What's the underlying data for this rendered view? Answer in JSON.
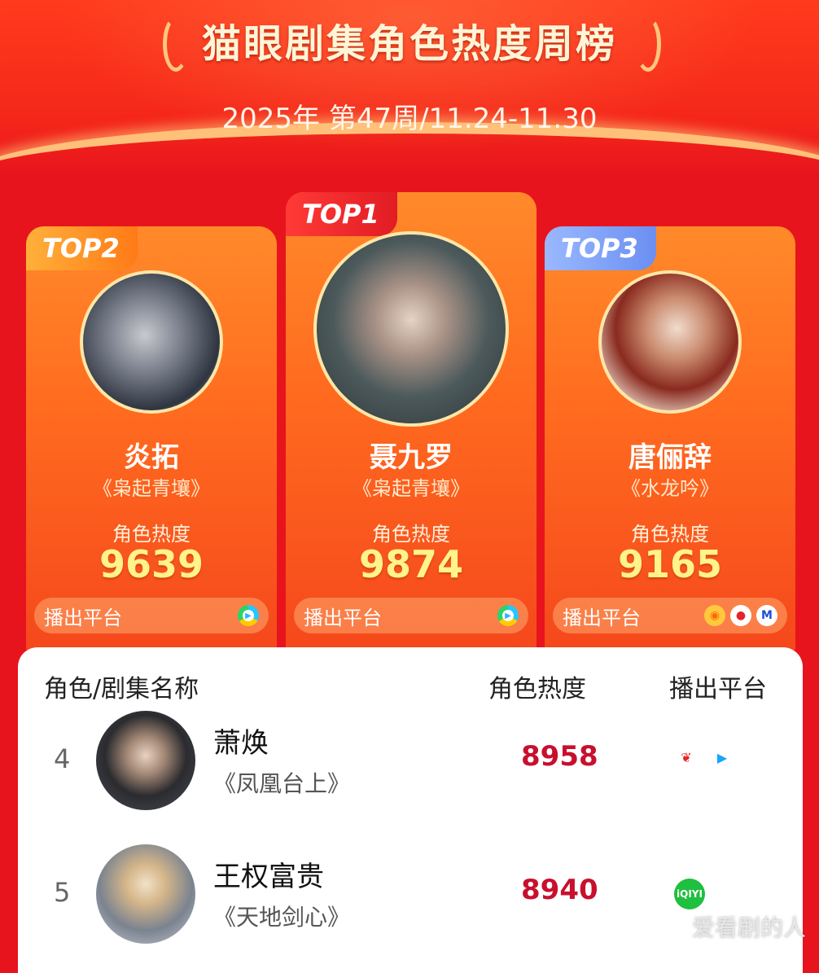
{
  "header": {
    "title": "猫眼剧集角色热度周榜",
    "subtitle": "2025年 第47周/11.24-11.30"
  },
  "top_cards": [
    {
      "rank_label": "TOP2",
      "name": "炎拓",
      "show": "《枭起青壤》",
      "heat_label": "角色热度",
      "heat": "9639",
      "platform_label": "播出平台",
      "platform_icons": [
        "youku-icon"
      ]
    },
    {
      "rank_label": "TOP1",
      "name": "聂九罗",
      "show": "《枭起青壤》",
      "heat_label": "角色热度",
      "heat": "9874",
      "platform_label": "播出平台",
      "platform_icons": [
        "youku-icon"
      ]
    },
    {
      "rank_label": "TOP3",
      "name": "唐俪辞",
      "show": "《水龙吟》",
      "heat_label": "角色热度",
      "heat": "9165",
      "platform_label": "播出平台",
      "platform_icons": [
        "mango-icon",
        "red-icon",
        "mgtv-icon"
      ]
    }
  ],
  "list": {
    "headers": {
      "col1": "角色/剧集名称",
      "col2": "角色热度",
      "col3": "播出平台"
    },
    "rows": [
      {
        "rank": "4",
        "name": "萧焕",
        "show": "《凤凰台上》",
        "heat": "8958",
        "platform_icons": [
          "tencent-video-icon",
          "play-icon"
        ]
      },
      {
        "rank": "5",
        "name": "王权富贵",
        "show": "《天地剑心》",
        "heat": "8940",
        "platform_icons": [
          "iqiyi-icon"
        ]
      }
    ]
  },
  "watermark": "爱看剧的人",
  "colors": {
    "background": "#e8141d",
    "heat_highlight": "#fff38a",
    "list_heat": "#c8102e"
  }
}
